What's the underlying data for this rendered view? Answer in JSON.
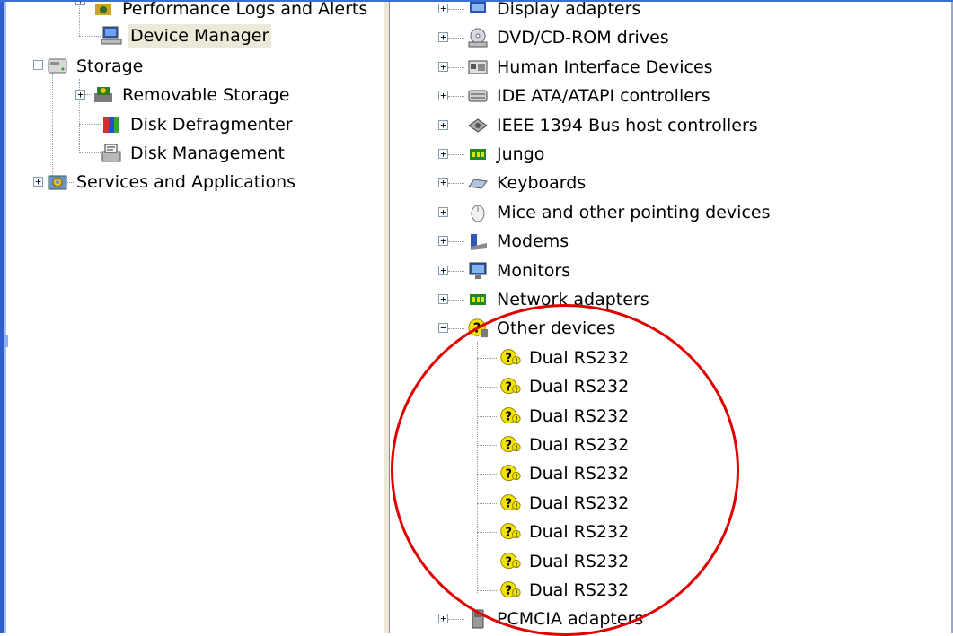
{
  "left_tree": {
    "items": [
      {
        "label": "Performance Logs and Alerts",
        "icon": "performance-icon"
      },
      {
        "label": "Device Manager",
        "icon": "device-manager-icon"
      },
      {
        "label": "Storage",
        "icon": "storage-icon"
      },
      {
        "label": "Removable Storage",
        "icon": "removable-storage-icon"
      },
      {
        "label": "Disk Defragmenter",
        "icon": "disk-defragmenter-icon"
      },
      {
        "label": "Disk Management",
        "icon": "disk-management-icon"
      },
      {
        "label": "Services and Applications",
        "icon": "services-icon"
      }
    ],
    "selected_item": "Device Manager"
  },
  "device_tree": {
    "categories": [
      {
        "label": "Display adapters",
        "icon": "display-adapter-icon"
      },
      {
        "label": "DVD/CD-ROM drives",
        "icon": "dvd-drive-icon"
      },
      {
        "label": "Human Interface Devices",
        "icon": "hid-icon"
      },
      {
        "label": "IDE ATA/ATAPI controllers",
        "icon": "ide-controller-icon"
      },
      {
        "label": "IEEE 1394 Bus host controllers",
        "icon": "ieee1394-icon"
      },
      {
        "label": "Jungo",
        "icon": "jungo-icon"
      },
      {
        "label": "Keyboards",
        "icon": "keyboard-icon"
      },
      {
        "label": "Mice and other pointing devices",
        "icon": "mouse-icon"
      },
      {
        "label": "Modems",
        "icon": "modem-icon"
      },
      {
        "label": "Monitors",
        "icon": "monitor-icon"
      },
      {
        "label": "Network adapters",
        "icon": "network-adapter-icon"
      },
      {
        "label": "Other devices",
        "icon": "unknown-device-icon"
      },
      {
        "label": "PCMCIA adapters",
        "icon": "pcmcia-icon"
      }
    ],
    "other_devices_children": [
      {
        "label": "Dual RS232",
        "icon": "warning-device-icon"
      },
      {
        "label": "Dual RS232",
        "icon": "warning-device-icon"
      },
      {
        "label": "Dual RS232",
        "icon": "warning-device-icon"
      },
      {
        "label": "Dual RS232",
        "icon": "warning-device-icon"
      },
      {
        "label": "Dual RS232",
        "icon": "warning-device-icon"
      },
      {
        "label": "Dual RS232",
        "icon": "warning-device-icon"
      },
      {
        "label": "Dual RS232",
        "icon": "warning-device-icon"
      },
      {
        "label": "Dual RS232",
        "icon": "warning-device-icon"
      },
      {
        "label": "Dual RS232",
        "icon": "warning-device-icon"
      }
    ]
  },
  "colors": {
    "highlight_circle": "#e00000",
    "window_border": "#2f5fcf",
    "selection_background": "#ece9d8"
  }
}
